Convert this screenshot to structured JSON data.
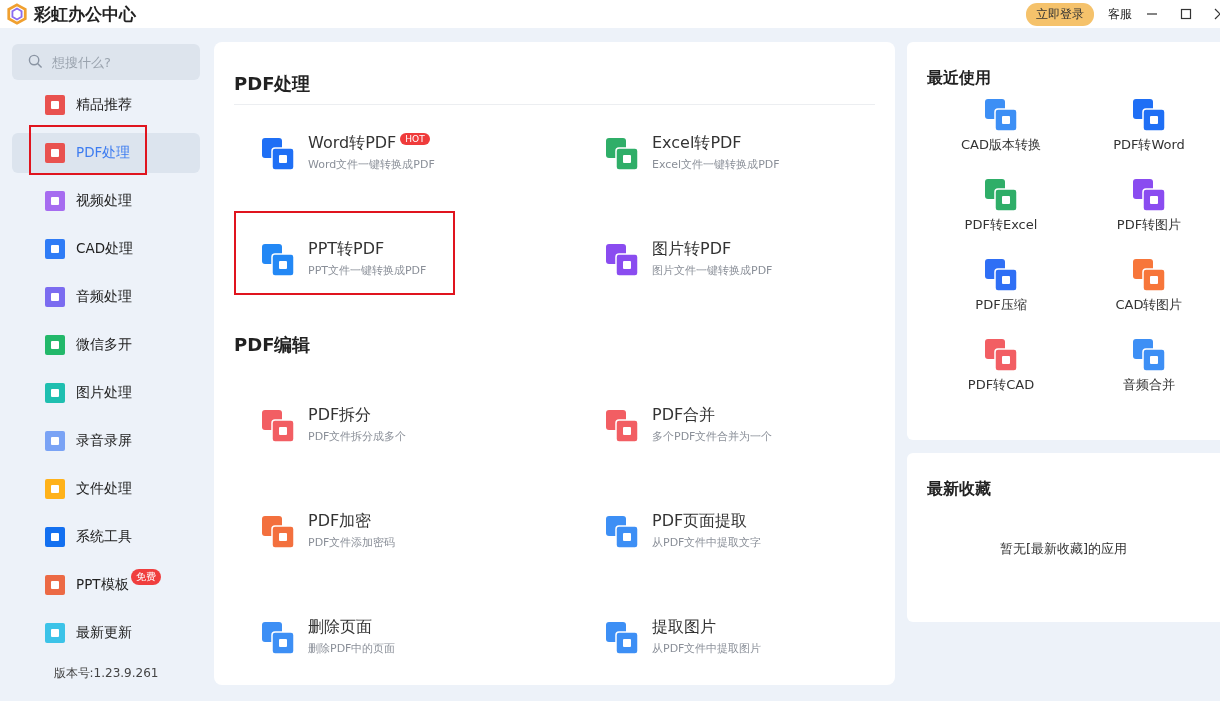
{
  "app": {
    "title": "彩虹办公中心",
    "login_button": "立即登录",
    "service_link": "客服"
  },
  "sidebar": {
    "search": {
      "placeholder": "想搜什么?"
    },
    "items": [
      {
        "label": "精品推荐",
        "selected": false,
        "highlighted": false,
        "color": "#e9524f"
      },
      {
        "label": "PDF处理",
        "selected": true,
        "highlighted": true,
        "color": "#e9524f"
      },
      {
        "label": "视频处理",
        "selected": false,
        "highlighted": false,
        "color": "#a66cf0"
      },
      {
        "label": "CAD处理",
        "selected": false,
        "highlighted": false,
        "color": "#2f7cf6"
      },
      {
        "label": "音频处理",
        "selected": false,
        "highlighted": false,
        "color": "#7b6cf0"
      },
      {
        "label": "微信多开",
        "selected": false,
        "highlighted": false,
        "color": "#22b86a"
      },
      {
        "label": "图片处理",
        "selected": false,
        "highlighted": false,
        "color": "#1fbfb0"
      },
      {
        "label": "录音录屏",
        "selected": false,
        "highlighted": false,
        "color": "#7aa3f5"
      },
      {
        "label": "文件处理",
        "selected": false,
        "highlighted": false,
        "color": "#ffb21a"
      },
      {
        "label": "系统工具",
        "selected": false,
        "highlighted": false,
        "color": "#1370f0"
      },
      {
        "label": "PPT模板",
        "selected": false,
        "highlighted": false,
        "color": "#ec6a45",
        "badge": "免费"
      },
      {
        "label": "最新更新",
        "selected": false,
        "highlighted": false,
        "color": "#3cc3e8"
      }
    ],
    "version": "版本号:1.23.9.261"
  },
  "sections": [
    {
      "title": "PDF处理",
      "tools": [
        {
          "name": "Word转PDF",
          "desc": "Word文件一键转换成PDF",
          "badge": "HOT",
          "highlighted": false,
          "color": "#1f6ff5"
        },
        {
          "name": "Excel转PDF",
          "desc": "Excel文件一键转换成PDF",
          "highlighted": false,
          "color": "#2fae68"
        },
        {
          "name": "PPT转PDF",
          "desc": "PPT文件一键转换成PDF",
          "highlighted": true,
          "color": "#2388f5"
        },
        {
          "name": "图片转PDF",
          "desc": "图片文件一键转换成PDF",
          "highlighted": false,
          "color": "#8a4cf0"
        }
      ]
    },
    {
      "title": "PDF编辑",
      "tools": [
        {
          "name": "PDF拆分",
          "desc": "PDF文件拆分成多个",
          "highlighted": false,
          "color": "#f25e63"
        },
        {
          "name": "PDF合并",
          "desc": "多个PDF文件合并为一个",
          "highlighted": false,
          "color": "#f25e63"
        },
        {
          "name": "PDF加密",
          "desc": "PDF文件添加密码",
          "highlighted": false,
          "color": "#f3703e"
        },
        {
          "name": "PDF页面提取",
          "desc": "从PDF文件中提取文字",
          "highlighted": false,
          "color": "#3d8ff5"
        },
        {
          "name": "删除页面",
          "desc": "删除PDF中的页面",
          "highlighted": false,
          "color": "#3d8ff5"
        },
        {
          "name": "提取图片",
          "desc": "从PDF文件中提取图片",
          "highlighted": false,
          "color": "#3d8ff5"
        }
      ]
    }
  ],
  "recent": {
    "title": "最近使用",
    "items": [
      {
        "label": "CAD版本转换",
        "color": "#3d8ff5"
      },
      {
        "label": "PDF转Word",
        "color": "#1f6ff5"
      },
      {
        "label": "PDF转Excel",
        "color": "#2fae68"
      },
      {
        "label": "PDF转图片",
        "color": "#8a4cf0"
      },
      {
        "label": "PDF压缩",
        "color": "#2f6ff5"
      },
      {
        "label": "CAD转图片",
        "color": "#f7763a"
      },
      {
        "label": "PDF转CAD",
        "color": "#f25e63"
      },
      {
        "label": "音频合并",
        "color": "#3d8ff5"
      }
    ]
  },
  "favorites": {
    "title": "最新收藏",
    "empty_text": "暂无[最新收藏]的应用"
  }
}
